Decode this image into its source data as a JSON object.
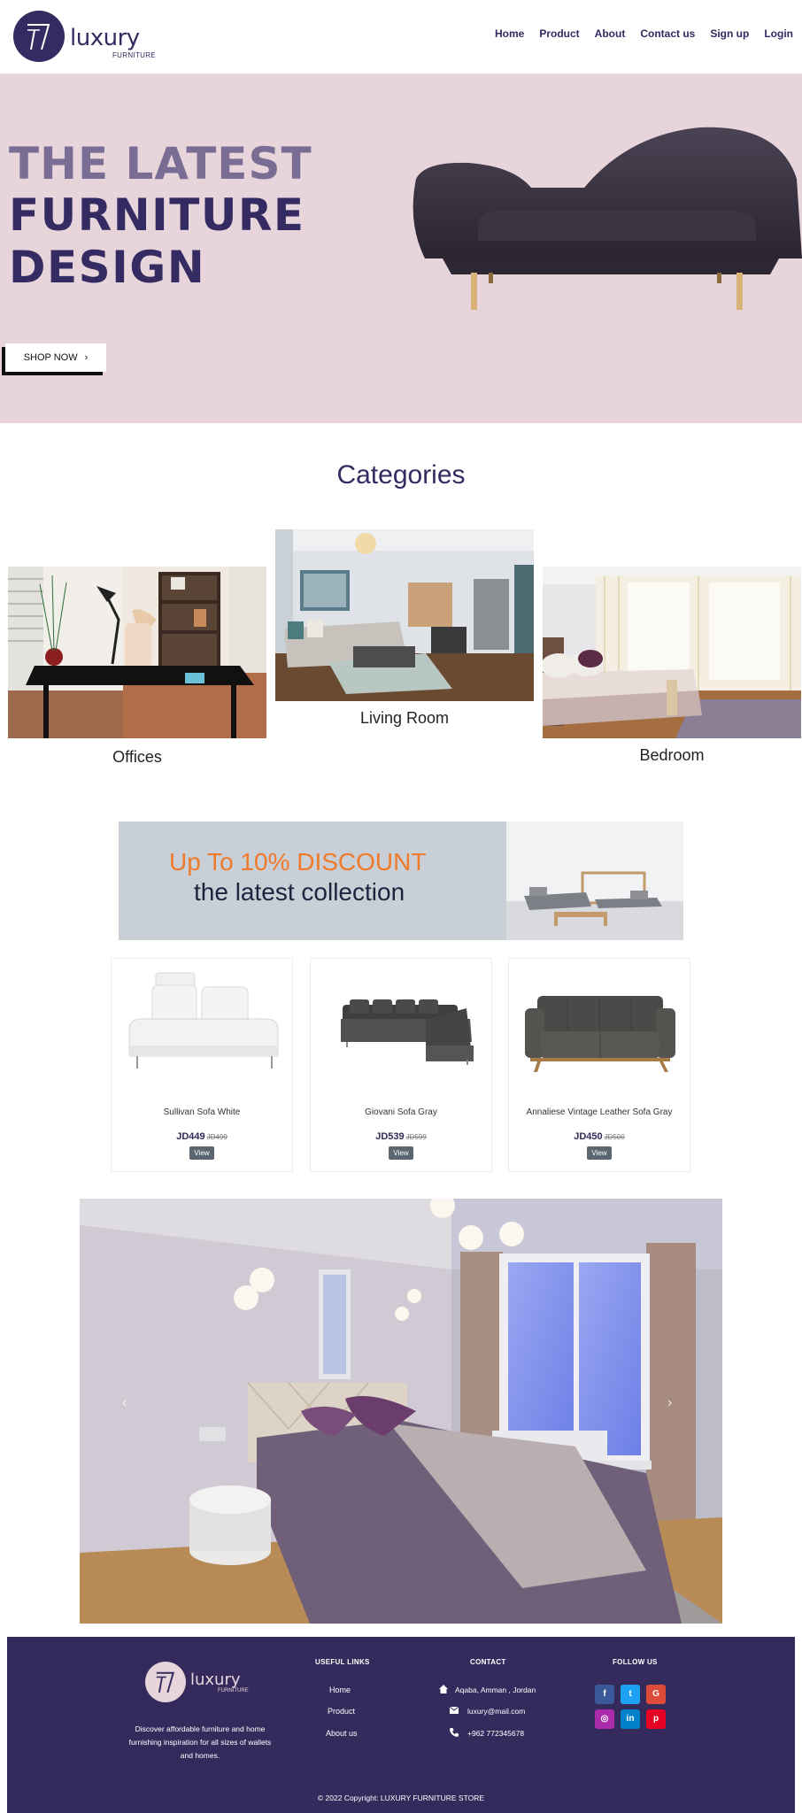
{
  "brand": {
    "word": "luxury",
    "sub": "FURNITURE"
  },
  "nav": {
    "items": [
      "Home",
      "Product",
      "About",
      "Contact us",
      "Sign up",
      "Login"
    ]
  },
  "hero": {
    "line1": "THE LATEST",
    "line2": "FURNITURE",
    "line3": "DESIGN",
    "button_label": "SHOP NOW",
    "button_icon": "chevron-right-icon"
  },
  "categories": {
    "title": "Categories",
    "items": [
      {
        "label": "Offices"
      },
      {
        "label": "Living Room"
      },
      {
        "label": "Bedroom"
      }
    ]
  },
  "discount": {
    "line1": "Up To 10% DISCOUNT",
    "line2": "the latest collection"
  },
  "products": [
    {
      "name": "Sullivan Sofa White",
      "price": "JD449",
      "old_price": "JD499",
      "button": "View"
    },
    {
      "name": "Giovani Sofa Gray",
      "price": "JD539",
      "old_price": "JD599",
      "button": "View"
    },
    {
      "name": "Annaliese Vintage Leather Sofa Gray",
      "price": "JD450",
      "old_price": "JD500",
      "button": "View"
    }
  ],
  "carousel": {
    "prev_icon": "chevron-left-icon",
    "next_icon": "chevron-right-icon"
  },
  "footer": {
    "brand_word": "luxury",
    "brand_sub": "FURNITURE",
    "description": "Discover affordable furniture and home furnishing inspiration for all sizes of wallets and homes.",
    "useful_links_title": "USEFUL LINKS",
    "links": [
      "Home",
      "Product",
      "About us"
    ],
    "contact_title": "CONTACT",
    "address": "Aqaba, Amman , Jordan",
    "email": "luxury@mail.com",
    "phone": "+962 772345678",
    "follow_title": "FOLLOW US",
    "social": [
      {
        "icon": "facebook-icon",
        "glyph": "f",
        "color": "#3b5998"
      },
      {
        "icon": "twitter-icon",
        "glyph": "t",
        "color": "#1da1f2"
      },
      {
        "icon": "google-icon",
        "glyph": "G",
        "color": "#dd4b39"
      },
      {
        "icon": "instagram-icon",
        "glyph": "◎",
        "color": "#ac2bac"
      },
      {
        "icon": "linkedin-icon",
        "glyph": "in",
        "color": "#0082ca"
      },
      {
        "icon": "pinterest-icon",
        "glyph": "p",
        "color": "#e60023"
      }
    ],
    "copyright": "© 2022 Copyright: LUXURY FURNITURE STORE"
  },
  "colors": {
    "primary": "#332b61",
    "hero_bg": "#e8d5db",
    "accent": "#f07a2a"
  }
}
